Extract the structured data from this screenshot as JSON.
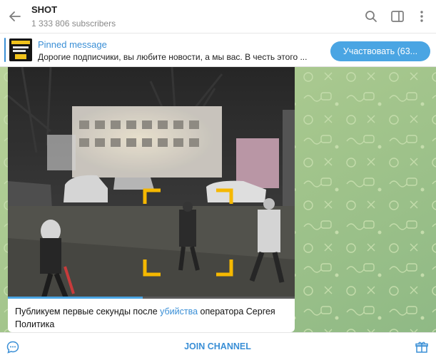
{
  "header": {
    "title": "SHOT",
    "subscribers": "1 333 806 subscribers"
  },
  "pinned": {
    "title": "Pinned message",
    "text": "Дорогие подписчики, вы любите новости, а мы вас. В честь этого ...",
    "button_label": "Участвовать (63..."
  },
  "message": {
    "video_progress": 0.47,
    "caption_before": "Публикуем первые секунды после ",
    "caption_link": "убийства",
    "caption_after": " оператора Сергея Политика"
  },
  "footer": {
    "join_label": "JOIN CHANNEL"
  },
  "colors": {
    "accent": "#3a8fd6",
    "button": "#4aa5e3",
    "chat_background": "#a8c68f",
    "focus_frame": "#f5b800"
  },
  "icons": [
    "back-arrow-icon",
    "search-icon",
    "sidebar-toggle-icon",
    "more-vertical-icon",
    "chat-bubble-icon",
    "gift-icon"
  ]
}
